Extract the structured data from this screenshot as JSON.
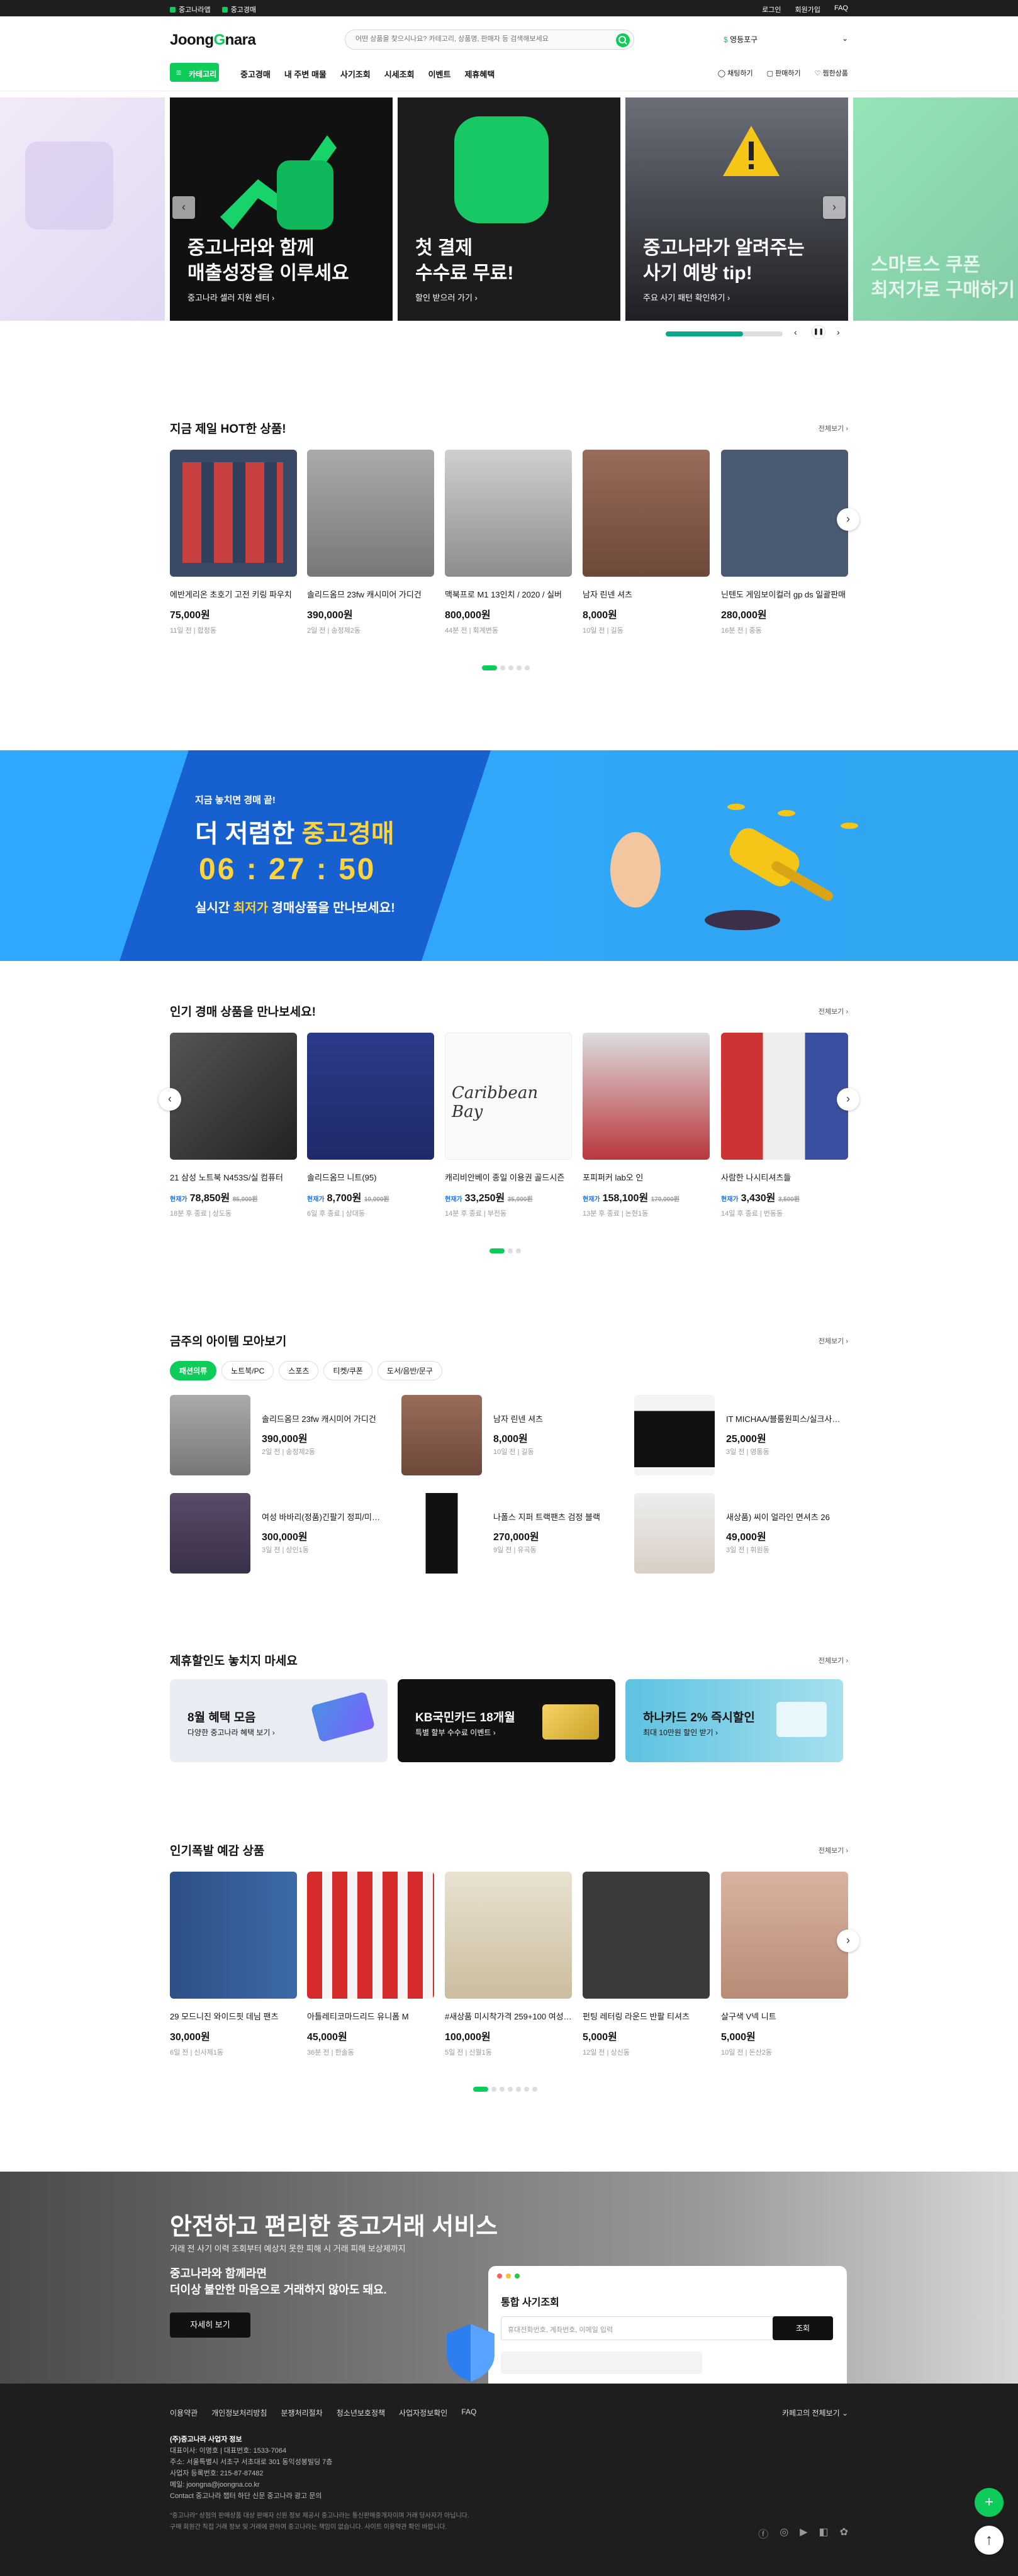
{
  "topbar": {
    "left": [
      "중고나라앱",
      "중고경매"
    ],
    "right": [
      "로그인",
      "회원가입",
      "FAQ"
    ]
  },
  "header": {
    "logo_a": "Joong",
    "logo_b": "G",
    "logo_c": "nara",
    "search_placeholder": "어떤 상품을 찾으시나요? 카테고리, 상품명, 판매자 등 검색해보세요",
    "location": "영등포구"
  },
  "nav": {
    "menu": "카테고리",
    "items": [
      "중고경매",
      "내 주변 매물",
      "사기조회",
      "시세조회",
      "이벤트",
      "제휴혜택"
    ],
    "right": [
      "채팅하기",
      "판매하기",
      "찜한상품"
    ]
  },
  "banners": [
    {
      "t1": "",
      "t2": ""
    },
    {
      "t1": "중고나라와 함께\n매출성장을 이루세요",
      "t2": "중고나라 셀러 지원 센터 ›"
    },
    {
      "t1": "첫 결제\n수수료 무료!",
      "t2": "할인 받으러 가기 ›"
    },
    {
      "t1": "중고나라가 알려주는\n사기 예방 tip!",
      "t2": "주요 사기 패턴 확인하기 ›"
    },
    {
      "t1": "스마트스 쿠폰\n최저가로 구매하기",
      "t2": ""
    }
  ],
  "hot": {
    "title": "지금 제일 HOT한 상품!",
    "more": "전체보기 ›",
    "items": [
      {
        "name": "에반게리온 초호기 고전 키링 파우치",
        "price": "75,000원",
        "meta": "11일 전 | 합정동"
      },
      {
        "name": "솔리드옴므 23fw 캐시미어 가디건",
        "price": "390,000원",
        "meta": "2일 전 | 송정제2동"
      },
      {
        "name": "맥북프로 M1 13인치 / 2020 / 실버",
        "price": "800,000원",
        "meta": "44분 전 | 회계변동"
      },
      {
        "name": "남자 린넨 셔츠",
        "price": "8,000원",
        "meta": "10일 전 | 길동"
      },
      {
        "name": "닌텐도 게임보이컬러 gp ds 일괄판매",
        "price": "280,000원",
        "meta": "16분 전 | 중동"
      }
    ]
  },
  "auction_banner": {
    "kicker": "지금 놓치면 경매 끝!",
    "title_a": "더 저렴한 ",
    "title_b": "중고경매",
    "timer": "06 : 27 : 50",
    "sub_a": "실시간 ",
    "sub_b": "최저가",
    "sub_c": " 경매상품을 만나보세요!"
  },
  "auction": {
    "title": "인기 경매 상품을 만나보세요!",
    "more": "전체보기 ›",
    "now": "현재가",
    "items": [
      {
        "name": "21 삼성 노트북 N453S/실 컴퓨터",
        "price": "78,850원",
        "orig": "85,000원",
        "meta": "18분 후 종료 | 상도동"
      },
      {
        "name": "솔리드옴므 니트(95)",
        "price": "8,700원",
        "orig": "10,000원",
        "meta": "6일 후 종료 | 상대동"
      },
      {
        "name": "캐리비안베이 종일 이용권 골드시즌",
        "price": "33,250원",
        "orig": "35,000원",
        "meta": "14분 후 종료 | 부전동"
      },
      {
        "name": "포피퍼커 lab오 인",
        "price": "158,100원",
        "orig": "170,000원",
        "meta": "13분 후 종료 | 논현1동"
      },
      {
        "name": "사람한 나시티셔츠들",
        "price": "3,430원",
        "orig": "3,500원",
        "meta": "14일 후 종료 | 번동동"
      }
    ]
  },
  "curated": {
    "title": "금주의 아이템 모아보기",
    "more": "전체보기 ›",
    "chips": [
      "패션의류",
      "노트북/PC",
      "스포츠",
      "티켓/쿠폰",
      "도서/음반/문구"
    ],
    "items": [
      {
        "name": "솔리드옴므 23fw 캐시미어 가디건",
        "price": "390,000원",
        "meta": "2일 전 | 송정제2동"
      },
      {
        "name": "남자 린넨 셔츠",
        "price": "8,000원",
        "meta": "10일 전 | 길동"
      },
      {
        "name": "IT MICHAA/블룸원피스/실크사이즈",
        "price": "25,000원",
        "meta": "3일 전 | 영통동"
      },
      {
        "name": "여성 바바리(정품)긴팔기 정피/미사용",
        "price": "300,000원",
        "meta": "3일 전 | 상인1동"
      },
      {
        "name": "나폴스 지퍼 트랙팬츠 검정 블랙",
        "price": "270,000원",
        "meta": "9일 전 | 유곡동"
      },
      {
        "name": "새상품) 씨이 얼라인 면셔츠 26",
        "price": "49,000원",
        "meta": "3일 전 | 휘원동"
      }
    ]
  },
  "partner": {
    "title": "제휴할인도 놓치지 마세요",
    "more": "전체보기 ›",
    "cards": [
      {
        "a": "8월 혜택 모음",
        "b": "다양한 중고나라 혜택 보기 ›"
      },
      {
        "a": "KB국민카드 18개월",
        "b": "특별 할부 수수료 이벤트 ›"
      },
      {
        "a": "하나카드 2% 즉시할인",
        "b": "최대 10만원 할인 받기 ›"
      }
    ]
  },
  "popular": {
    "title": "인기폭발 예감 상품",
    "more": "전체보기 ›",
    "items": [
      {
        "name": "29 모드니진 와이드핏 데님 팬츠",
        "price": "30,000원",
        "meta": "6일 전 | 신사제1동"
      },
      {
        "name": "아틀레티코마드리드 유니폼 M",
        "price": "45,000원",
        "meta": "36분 전 | 한솔동"
      },
      {
        "name": "#새상품 미시착가격 259+100 여성자켓",
        "price": "100,000원",
        "meta": "5일 전 | 신월1동"
      },
      {
        "name": "펀팅 레터링 라운드 반팔 티셔츠",
        "price": "5,000원",
        "meta": "12일 전 | 상신동"
      },
      {
        "name": "살구색 V넥 니트",
        "price": "5,000원",
        "meta": "10일 전 | 돈산2동"
      }
    ]
  },
  "service": {
    "title": "안전하고 편리한 중고거래 서비스",
    "sub": "거래 전 사기 이력 조회부터 예상치 못한 피해 시 거래 피해 보상제까지",
    "p1": "중고나라와 함께라면",
    "p2": "더이상 불안한 마음으로 거래하지 않아도 돼요.",
    "btn": "자세히 보기",
    "card_title": "통합 사기조회",
    "card_ph": "휴대전화번호, 계좌번호, 이메일 입력",
    "card_btn": "조회"
  },
  "footer": {
    "links": [
      "이용약관",
      "개인정보처리방침",
      "분쟁처리절차",
      "청소년보호정책",
      "사업자정보확인",
      "FAQ"
    ],
    "cafe": "카페고의 전체보기 ⌄",
    "company": "(주)중고나라 사업자 정보",
    "info": [
      "대표이사: 이명호 | 대표번호: 1533-7064",
      "주소: 서울특별시 서초구 서초대로 301 동익성봉빌딩 7층",
      "사업자 등록번호: 215-87-87482",
      "메일: joongna@joongna.co.kr",
      "Contact 중고나라 챕터 하단 신문 중고나라 광고 문의"
    ],
    "legal": "\"중고나라\" 상점의 판매상품 대상 판매자 신원 정보 제공시 중고나라는 통신판매중개자이며 거래 당사자가 아닙니다.",
    "legal2": "구매 회원간 직접 거래 정보 및 거래에 관하여 중고나라는 책임이 없습니다. 사이트 이용약관 확인 바랍니다."
  }
}
